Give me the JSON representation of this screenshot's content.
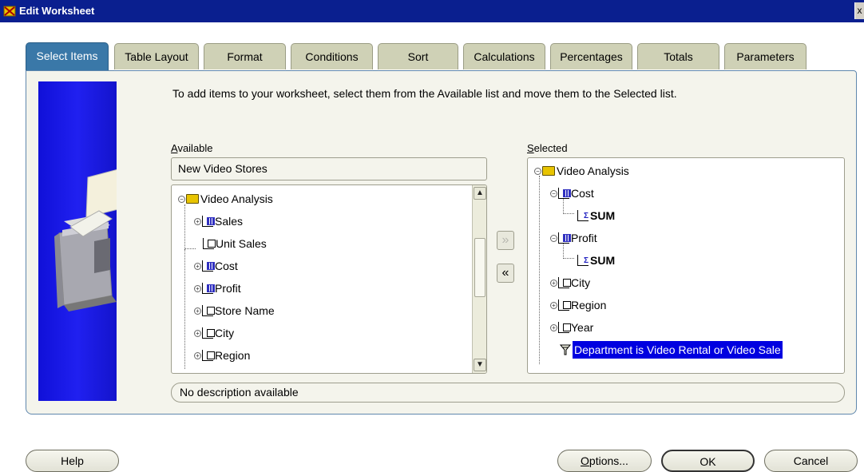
{
  "window": {
    "title": "Edit Worksheet",
    "close_glyph": "x"
  },
  "tabs": [
    {
      "label": "Select Items",
      "active": true
    },
    {
      "label": "Table Layout"
    },
    {
      "label": "Format"
    },
    {
      "label": "Conditions"
    },
    {
      "label": "Sort"
    },
    {
      "label": "Calculations"
    },
    {
      "label": "Percentages"
    },
    {
      "label": "Totals"
    },
    {
      "label": "Parameters"
    }
  ],
  "instructions": "To add items to your worksheet, select them from the Available list and move them to the Selected list.",
  "available": {
    "label_prefix": "A",
    "label_rest": "vailable",
    "dropdown_value": "New Video Stores",
    "items": [
      {
        "label": "Video Analysis",
        "icon": "folder-icon",
        "expander": "minus"
      },
      {
        "label": "Sales",
        "icon": "numeric-item-icon",
        "expander": "plus"
      },
      {
        "label": "Unit Sales",
        "icon": "item-icon",
        "expander": ""
      },
      {
        "label": "Cost",
        "icon": "numeric-item-icon",
        "expander": "plus"
      },
      {
        "label": "Profit",
        "icon": "numeric-item-icon",
        "expander": "plus"
      },
      {
        "label": "Store Name",
        "icon": "item-icon",
        "expander": "plus"
      },
      {
        "label": "City",
        "icon": "item-icon",
        "expander": "plus"
      },
      {
        "label": "Region",
        "icon": "item-icon",
        "expander": "plus"
      }
    ]
  },
  "selected": {
    "label_prefix": "S",
    "label_rest": "elected",
    "items": [
      {
        "label": "Video Analysis",
        "icon": "folder-icon",
        "expander": "minus"
      },
      {
        "label": "Cost",
        "icon": "numeric-item-icon",
        "expander": "minus"
      },
      {
        "label": "SUM",
        "icon": "aggregate-icon",
        "expander": ""
      },
      {
        "label": "Profit",
        "icon": "numeric-item-icon",
        "expander": "minus"
      },
      {
        "label": "SUM",
        "icon": "aggregate-icon",
        "expander": ""
      },
      {
        "label": "City",
        "icon": "item-icon",
        "expander": "plus"
      },
      {
        "label": "Region",
        "icon": "item-icon",
        "expander": "plus"
      },
      {
        "label": "Year",
        "icon": "item-icon",
        "expander": "plus"
      },
      {
        "label": "Department is Video Rental or Video Sale",
        "icon": "filter-funnel-icon",
        "expander": ""
      }
    ]
  },
  "move_buttons": {
    "add": "»",
    "remove": "«"
  },
  "description": "No description available",
  "buttons": {
    "help": "Help",
    "options_prefix": "O",
    "options_rest": "ptions...",
    "ok": "OK",
    "cancel": "Cancel"
  },
  "colors": {
    "titlebar": "#0a1f8f",
    "active_tab": "#3a78a8",
    "selection": "#0000e0"
  }
}
